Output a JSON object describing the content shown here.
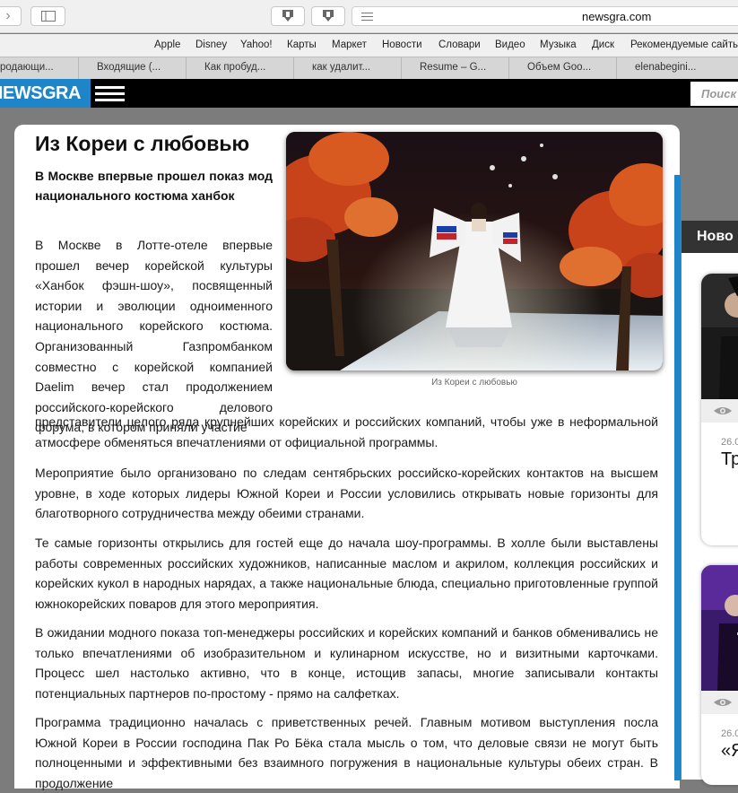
{
  "browser": {
    "url": "newsgra.com",
    "back_icon": "chevron-right-icon",
    "bookmarks": [
      "Apple",
      "Disney",
      "Yahoo!",
      "Карты",
      "Маркет",
      "Новости",
      "Словари",
      "Видео",
      "Музыка",
      "Диск",
      "Рекомендуемые сайты"
    ],
    "tabs": [
      "родающи...",
      "Входящие (...",
      "Как пробуд...",
      "как удалит...",
      "Resume – G...",
      "Объем Goo...",
      "elenabegini..."
    ]
  },
  "site": {
    "logo": "NEWSGRA",
    "search_placeholder": "Поиск"
  },
  "article": {
    "title": "Из Кореи с любовью",
    "lead": "В Москве впервые прошел показ мод национального костюма ханбок",
    "image_caption": "Из Кореи с любовью",
    "p1_start": "В Москве в Лотте-отеле впервые прошел вечер корейской культуры «Ханбок фэшн-шоу», посвященный истории и эволюции одноименного национального корейского костюма. Организованный Газпромбанком совместно с корейской компанией Daelim вечер стал продолжением российского-корейского делового форума, в котором приняли участие",
    "p1_end": "представители целого ряда крупнейших корейских и российских компаний, чтобы уже в неформальной атмосфере обменяться впечатлениями от официальной программы.",
    "p2": "Мероприятие было организовано по следам сентябрьских российско-корейских контактов на высшем уровне, в ходе которых лидеры Южной Кореи и России условились открывать новые горизонты для благотворного сотрудничества между обеими странами.",
    "p3": "Те самые горизонты открылись для гостей еще до начала шоу-программы. В холле были выставлены работы современных российских художников, написанные маслом и акрилом, коллекция российских и корейских кукол в народных нарядах, а также национальные блюда, специально приготовленные группой южнокорейских поваров для этого мероприятия.",
    "p4": "В ожидании модного показа топ-менеджеры российских и корейских компаний и банков обменивались не только впечатлениями об изобразительном и кулинарном искусстве, но и визитными карточками. Процесс шел настолько активно, что в конце, истощив запасы, многие записывали контакты потенциальных партнеров по-простому - прямо на салфетках.",
    "p5": "Программа традиционно началась с приветственных речей. Главным мотивом выступления посла Южной Кореи в России господина Пак Ро Бёка стала мысль о том, что деловые связи не могут быть полноценными и эффективными без взаимного погружения в национальные культуры обеих стран. В продолжение"
  },
  "sidebar": {
    "header": "Ново",
    "cards": [
      {
        "date": "26.0",
        "title": "Тр"
      },
      {
        "date": "26.0",
        "title": "«Я"
      }
    ]
  },
  "colors": {
    "brand_blue": "#1e86c8",
    "header_black": "#000000",
    "page_gray": "#7c7c7c"
  }
}
